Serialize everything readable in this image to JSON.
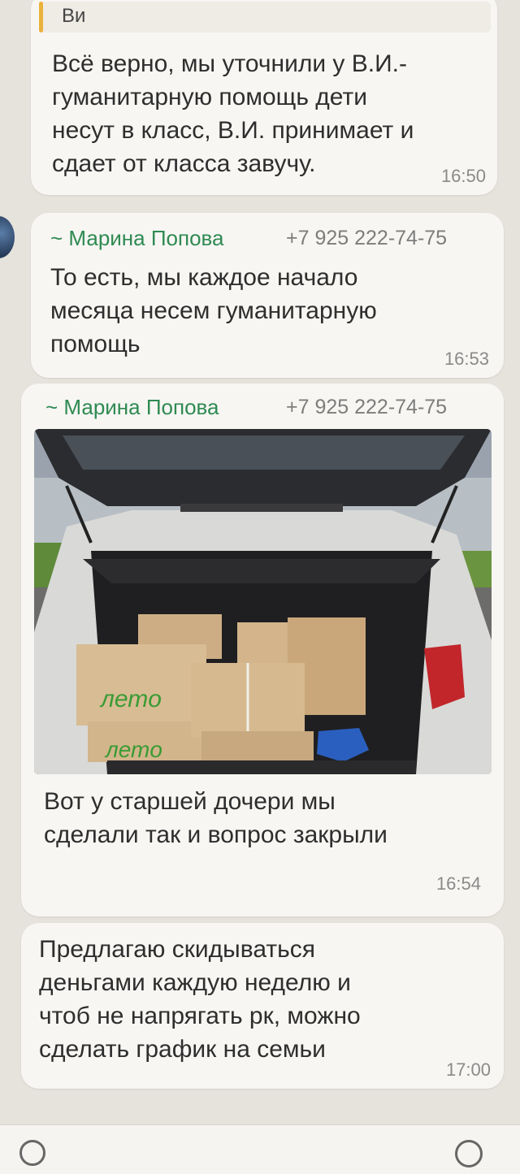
{
  "messages": [
    {
      "quote_author": "Ви",
      "text": "Всё верно, мы уточнили у В.И.-\nгуманитарную помощь дети\nнесут в класс, В.И. принимает и\nсдает от класса завучу.",
      "time": "16:50"
    },
    {
      "sender": "~ Марина Попова",
      "phone": "+7 925 222-74-75",
      "text": "То есть, мы каждое начало\nмесяца несем гуманитарную\nпомощь",
      "time": "16:53"
    },
    {
      "sender": "~ Марина Попова",
      "phone": "+7 925 222-74-75",
      "box_label_1": "летo",
      "box_label_2": "летo",
      "text": "Вот у старшей дочери мы\nсделали так и вопрос закрыли",
      "time": "16:54"
    },
    {
      "text": "Предлагаю скидываться\nденьгами каждую неделю и\nчтоб не напрягать рк, можно\nсделать график на семьи",
      "time": "17:00"
    }
  ],
  "colors": {
    "background": "#e6e2dc",
    "bubble": "#f7f6f3",
    "sender": "#2f8a52",
    "quote_bar": "#e9b23c"
  },
  "icons": [
    "avatar",
    "sticker-icon",
    "attach-icon"
  ]
}
